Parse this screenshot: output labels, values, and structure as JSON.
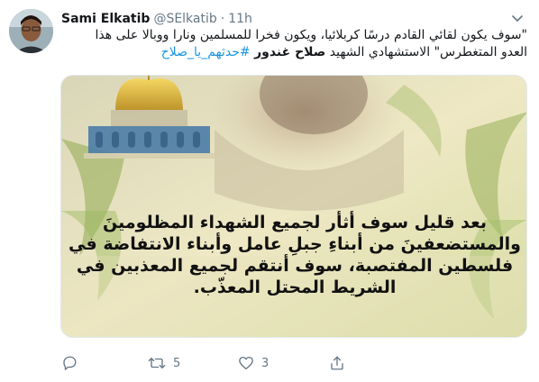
{
  "tweet": {
    "author": {
      "name": "Sami Elkatib",
      "handle": "@SElkatib",
      "separator": "·",
      "time": "11h"
    },
    "text": {
      "line1": "\"سوف يكون لقائي القادم درسًا كربلائيا، ويكون فخرا للمسلمين ونارا ووبالا على هذا",
      "line2_part1": "العدو المتغطرس\" الاستشهادي الشهيد ",
      "line2_bold": "صلاح غندور",
      "line2_hashtag": " #حدثهم_يا_صلاح"
    },
    "media": {
      "lines": [
        "بعد قليل سوف أثأر لجميع الشهداء المظلومينَ",
        "والمستضعفينَ من أبناءِ جبلِ عامل وأبناء الانتفاضة في",
        "فلسطين المفتصبة، سوف أنتقم لجميع المعذبين في",
        "الشريط المحتل المعذّب."
      ]
    },
    "actions": {
      "reply": {
        "icon": "reply-icon",
        "count": ""
      },
      "retweet": {
        "icon": "retweet-icon",
        "count": "5"
      },
      "like": {
        "icon": "heart-icon",
        "count": "3"
      },
      "share": {
        "icon": "share-icon",
        "count": ""
      }
    },
    "colors": {
      "text": "#14171a",
      "secondary": "#657786",
      "link": "#1b95e0",
      "border": "#e1e8ed"
    }
  }
}
